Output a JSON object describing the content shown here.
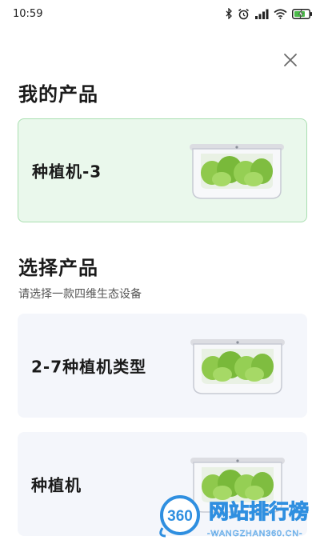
{
  "status_bar": {
    "time": "10:59",
    "icons": [
      "bluetooth-icon",
      "alarm-icon",
      "signal-icon",
      "wifi-icon",
      "battery-charging-icon"
    ]
  },
  "close_icon": "close-icon",
  "my_products": {
    "title": "我的产品",
    "items": [
      {
        "label": "种植机-3",
        "image": "planter-image"
      }
    ]
  },
  "select_product": {
    "title": "选择产品",
    "subtitle": "请选择一款四维生态设备",
    "items": [
      {
        "label": "2-7种植机类型",
        "image": "planter-image"
      },
      {
        "label": "种植机",
        "image": "planter-image"
      }
    ]
  },
  "watermark": {
    "badge": "360",
    "text": "网站排行榜",
    "url": "-WANGZHAN360.CN-"
  },
  "colors": {
    "selected_card_bg": "#eaf8ec",
    "selected_card_border": "#a9dfb0",
    "card_bg": "#f4f6fb",
    "watermark_blue": "#2f8fe0"
  }
}
